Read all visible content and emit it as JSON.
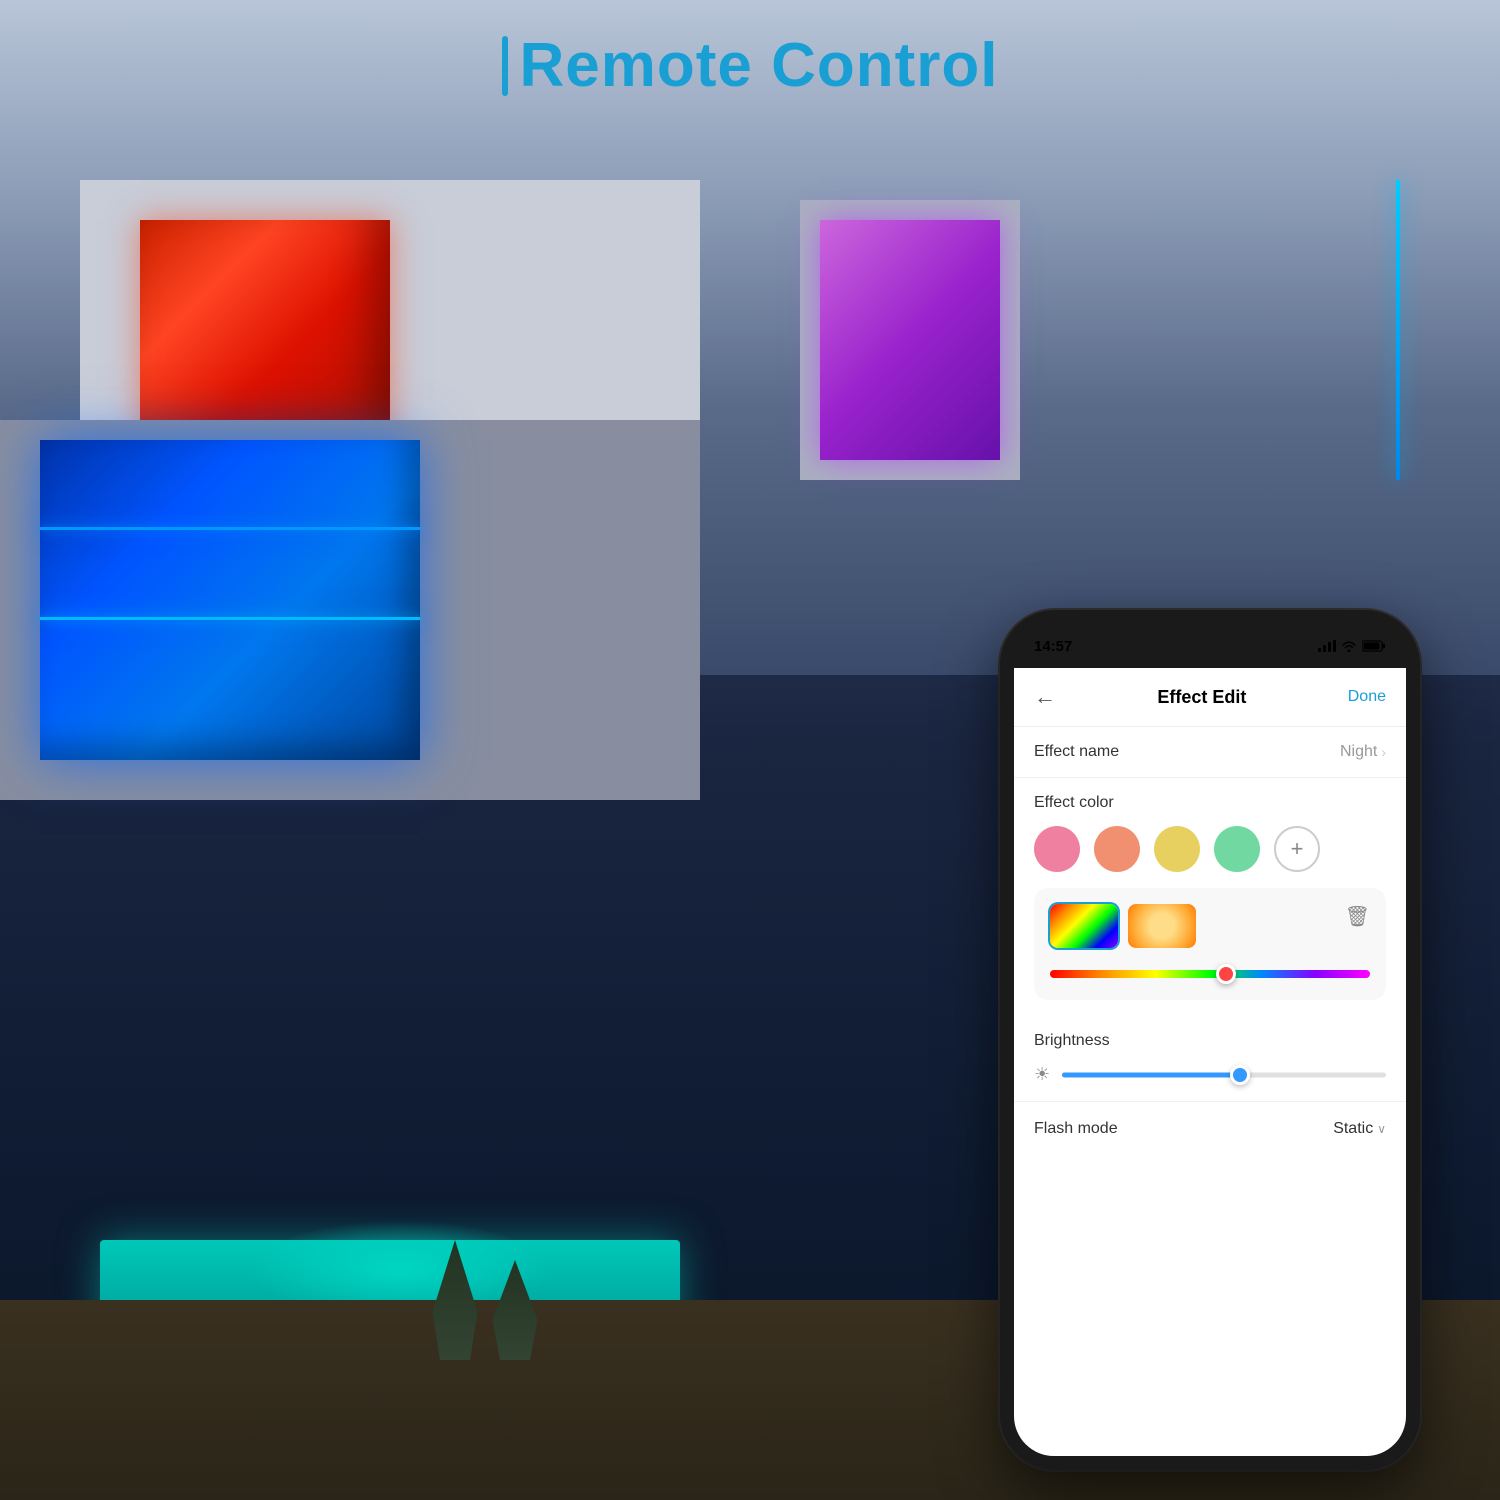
{
  "page": {
    "title": "Remote Control",
    "title_bar_icon": "bar-icon"
  },
  "phone": {
    "status": {
      "time": "14:57",
      "signal": "signal-icon",
      "wifi": "wifi-icon",
      "battery": "battery-icon"
    },
    "header": {
      "back_label": "←",
      "title": "Effect Edit",
      "done_label": "Done"
    },
    "effect_name": {
      "label": "Effect name",
      "value": "Night",
      "chevron": "›"
    },
    "effect_color": {
      "label": "Effect color",
      "colors": [
        {
          "id": "pink",
          "hex": "#f080a0"
        },
        {
          "id": "salmon",
          "hex": "#f09070"
        },
        {
          "id": "yellow",
          "hex": "#e8d060"
        },
        {
          "id": "mint",
          "hex": "#70d8a0"
        }
      ],
      "add_label": "+"
    },
    "color_editor": {
      "delete_icon": "🗑"
    },
    "brightness": {
      "label": "Brightness",
      "value": 55
    },
    "flash_mode": {
      "label": "Flash mode",
      "value": "Static",
      "dropdown_arrow": "∨"
    }
  }
}
